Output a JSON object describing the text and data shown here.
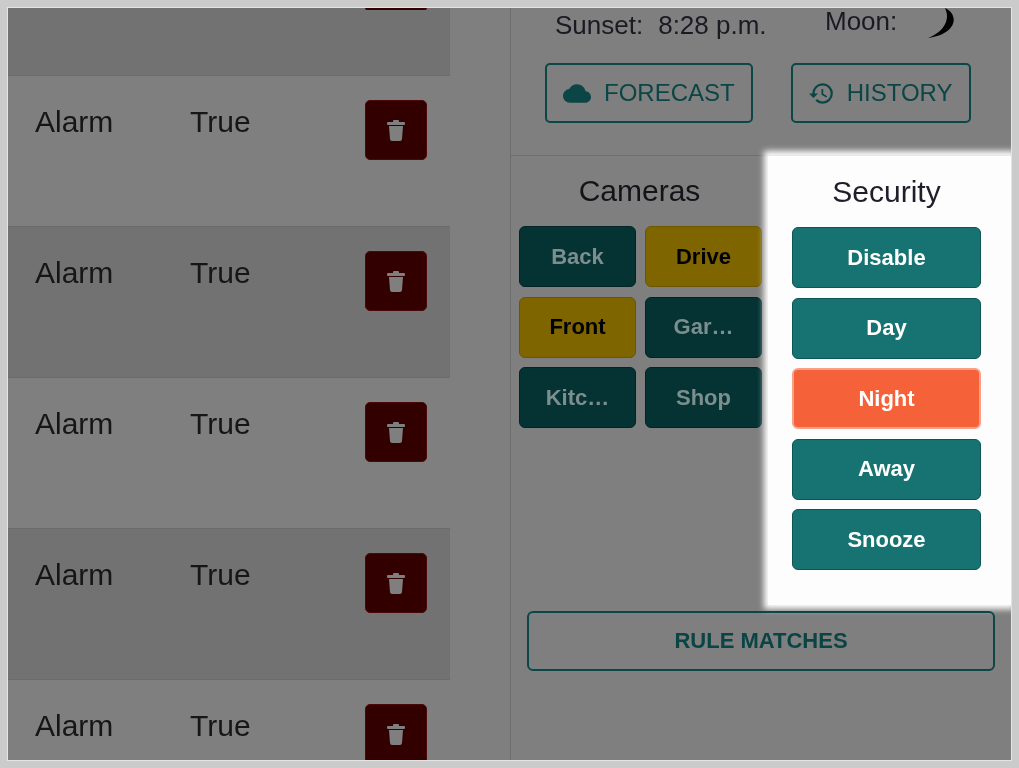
{
  "rules": {
    "rows": [
      {
        "name": "Alarm",
        "value": "True"
      },
      {
        "name": "Alarm",
        "value": "True"
      },
      {
        "name": "Alarm",
        "value": "True"
      },
      {
        "name": "Alarm",
        "value": "True"
      },
      {
        "name": "Alarm",
        "value": "True"
      }
    ]
  },
  "sun": {
    "label": "Sunset:",
    "time": "8:28 p.m."
  },
  "moon": {
    "label": "Moon:"
  },
  "actions": [
    {
      "kind": "forecast",
      "label": "FORECAST"
    },
    {
      "kind": "history",
      "label": "HISTORY"
    }
  ],
  "cameras": {
    "title": "Cameras",
    "items": [
      {
        "label": "Back",
        "on": false
      },
      {
        "label": "Drive",
        "on": true
      },
      {
        "label": "Front",
        "on": true
      },
      {
        "label": "Gar…",
        "on": false
      },
      {
        "label": "Kitc…",
        "on": false
      },
      {
        "label": "Shop",
        "on": false
      }
    ]
  },
  "security": {
    "title": "Security",
    "highlighted": true,
    "modes": [
      {
        "label": "Disable",
        "selected": false
      },
      {
        "label": "Day",
        "selected": false
      },
      {
        "label": "Night",
        "selected": true
      },
      {
        "label": "Away",
        "selected": false
      },
      {
        "label": "Snooze",
        "selected": false
      }
    ]
  },
  "rule_matches_button": {
    "label": "RULE MATCHES"
  }
}
